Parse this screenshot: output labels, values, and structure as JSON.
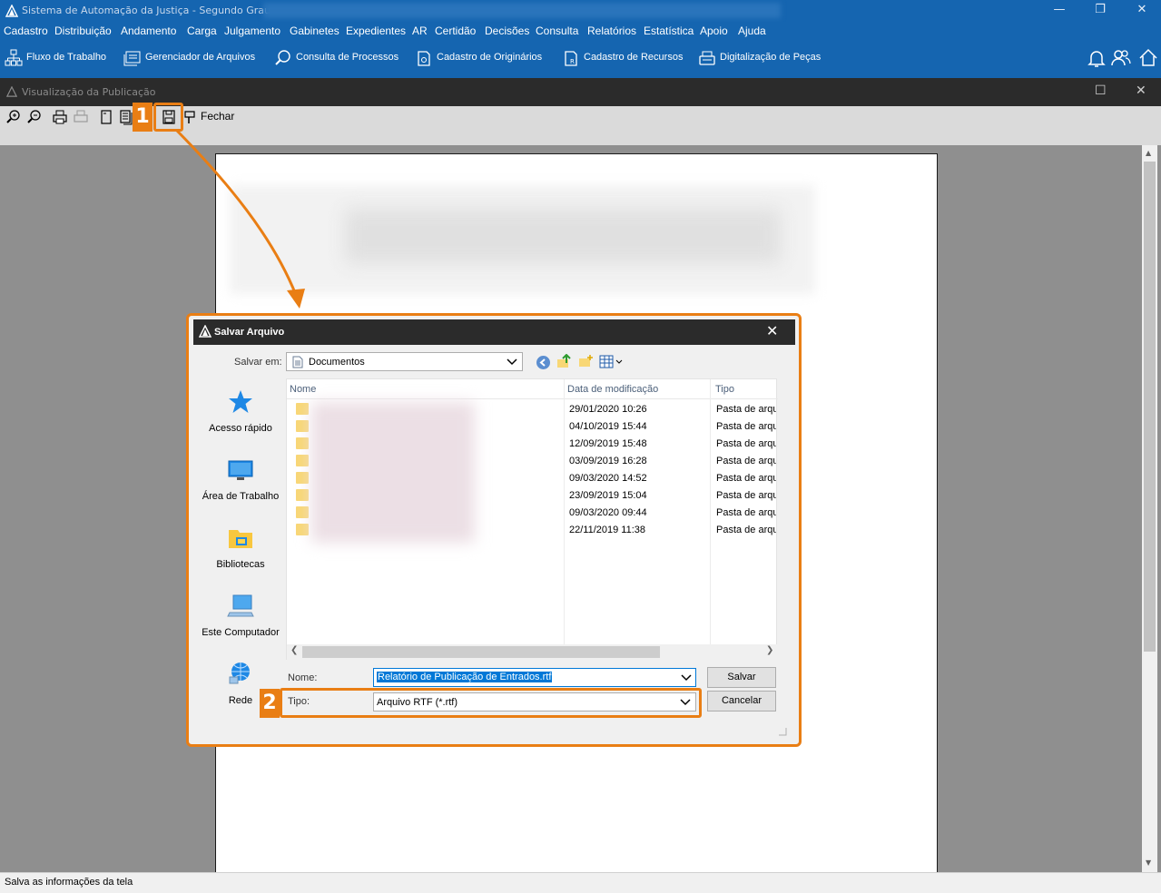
{
  "window": {
    "title": "Sistema de Automação da Justiça - Segundo Grau -",
    "controls": [
      "minimize",
      "restore",
      "close"
    ]
  },
  "menu": [
    "Cadastro",
    "Distribuição",
    "Andamento",
    "Carga",
    "Julgamento",
    "Gabinetes",
    "Expedientes",
    "AR",
    "Certidão",
    "Decisões",
    "Consulta",
    "Relatórios",
    "Estatística",
    "Apoio",
    "Ajuda"
  ],
  "toolbar": {
    "items": [
      {
        "label": "Fluxo de Trabalho",
        "icon": "org-chart-icon"
      },
      {
        "label": "Gerenciador de Arquivos",
        "icon": "file-manager-icon"
      },
      {
        "label": "Consulta de Processos",
        "icon": "search-process-icon"
      },
      {
        "label": "Cadastro de Originários",
        "icon": "originarios-icon"
      },
      {
        "label": "Cadastro de Recursos",
        "icon": "recursos-icon"
      },
      {
        "label": "Digitalização de Peças",
        "icon": "scanner-icon"
      }
    ],
    "right_icons": [
      "bell-icon",
      "users-icon",
      "home-icon"
    ]
  },
  "child_window": {
    "title": "Visualização da Publicação",
    "preview_toolbar": {
      "buttons": [
        "zoom-in-icon",
        "zoom-out-icon",
        "print-icon",
        "print-setup-icon",
        "single-page-icon",
        "multi-page-icon",
        "save-icon"
      ],
      "close_label": "Fechar"
    }
  },
  "callouts": {
    "step1": "1",
    "step2": "2"
  },
  "dialog": {
    "title": "Salvar Arquivo",
    "save_in_label": "Salvar em:",
    "save_in_value": "Documentos",
    "places": [
      {
        "label": "Acesso rápido",
        "icon": "star-icon"
      },
      {
        "label": "Área de Trabalho",
        "icon": "desktop-icon"
      },
      {
        "label": "Bibliotecas",
        "icon": "libraries-icon"
      },
      {
        "label": "Este Computador",
        "icon": "computer-icon"
      },
      {
        "label": "Rede",
        "icon": "network-icon"
      }
    ],
    "columns": {
      "name": "Nome",
      "date": "Data de modificação",
      "type": "Tipo"
    },
    "rows": [
      {
        "date": "29/01/2020 10:26",
        "type": "Pasta de arquivos"
      },
      {
        "date": "04/10/2019 15:44",
        "type": "Pasta de arquivos"
      },
      {
        "date": "12/09/2019 15:48",
        "type": "Pasta de arquivos"
      },
      {
        "date": "03/09/2019 16:28",
        "type": "Pasta de arquivos"
      },
      {
        "date": "09/03/2020 14:52",
        "type": "Pasta de arquivos"
      },
      {
        "date": "23/09/2019 15:04",
        "type": "Pasta de arquivos"
      },
      {
        "date": "09/03/2020 09:44",
        "type": "Pasta de arquivos"
      },
      {
        "date": "22/11/2019 11:38",
        "type": "Pasta de arquivos"
      }
    ],
    "name_label": "Nome:",
    "name_value": "Relatório de Publicação de Entrados.rtf",
    "type_label": "Tipo:",
    "type_value": "Arquivo RTF (*.rtf)",
    "save_button": "Salvar",
    "cancel_button": "Cancelar"
  },
  "status": "Salva as informações da tela",
  "colors": {
    "titlebar": "#1565b0",
    "accent": "#e97e14",
    "dark_bar": "#2b2b2b"
  }
}
